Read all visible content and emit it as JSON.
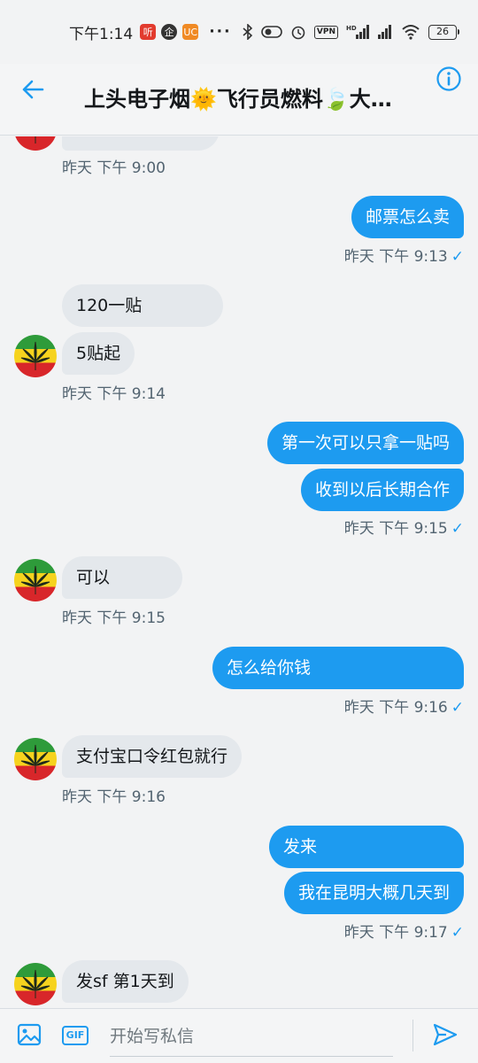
{
  "status_bar": {
    "time": "下午1:14",
    "app_icons": [
      "听",
      "企",
      "UC"
    ],
    "more": "···",
    "vpn": "VPN",
    "network": "HD",
    "battery": "26"
  },
  "header": {
    "title": "上头电子烟🌞飞行员燃料🍃大…",
    "back_icon": "back-arrow-icon",
    "info_icon": "info-icon"
  },
  "messages": [
    {
      "dir": "in",
      "text": "",
      "partial": true
    },
    {
      "dir": "in",
      "time": "昨天 下午 9:00"
    },
    {
      "dir": "out",
      "text": "邮票怎么卖",
      "time": "昨天 下午 9:13"
    },
    {
      "dir": "in",
      "text": "120一贴"
    },
    {
      "dir": "in",
      "text": "5贴起",
      "time": "昨天 下午 9:14"
    },
    {
      "dir": "out",
      "text": "第一次可以只拿一贴吗"
    },
    {
      "dir": "out",
      "text": "收到以后长期合作",
      "time": "昨天 下午 9:15"
    },
    {
      "dir": "in",
      "text": "可以",
      "time": "昨天 下午 9:15"
    },
    {
      "dir": "out",
      "text": "怎么给你钱",
      "time": "昨天 下午 9:16"
    },
    {
      "dir": "in",
      "text": "支付宝口令红包就行",
      "time": "昨天 下午 9:16"
    },
    {
      "dir": "out",
      "text": "发来"
    },
    {
      "dir": "out",
      "text": "我在昆明大概几天到",
      "time": "昨天 下午 9:17"
    },
    {
      "dir": "in",
      "text": "发sf 第1天到"
    }
  ],
  "read_mark": "✓",
  "composer": {
    "placeholder": "开始写私信",
    "gif_label": "GIF",
    "image_icon": "image-icon",
    "send_icon": "send-icon"
  },
  "colors": {
    "accent": "#1d9bf0",
    "incoming_bubble": "#e4e8ec",
    "timestamp": "#536471",
    "background": "#f2f3f4"
  }
}
